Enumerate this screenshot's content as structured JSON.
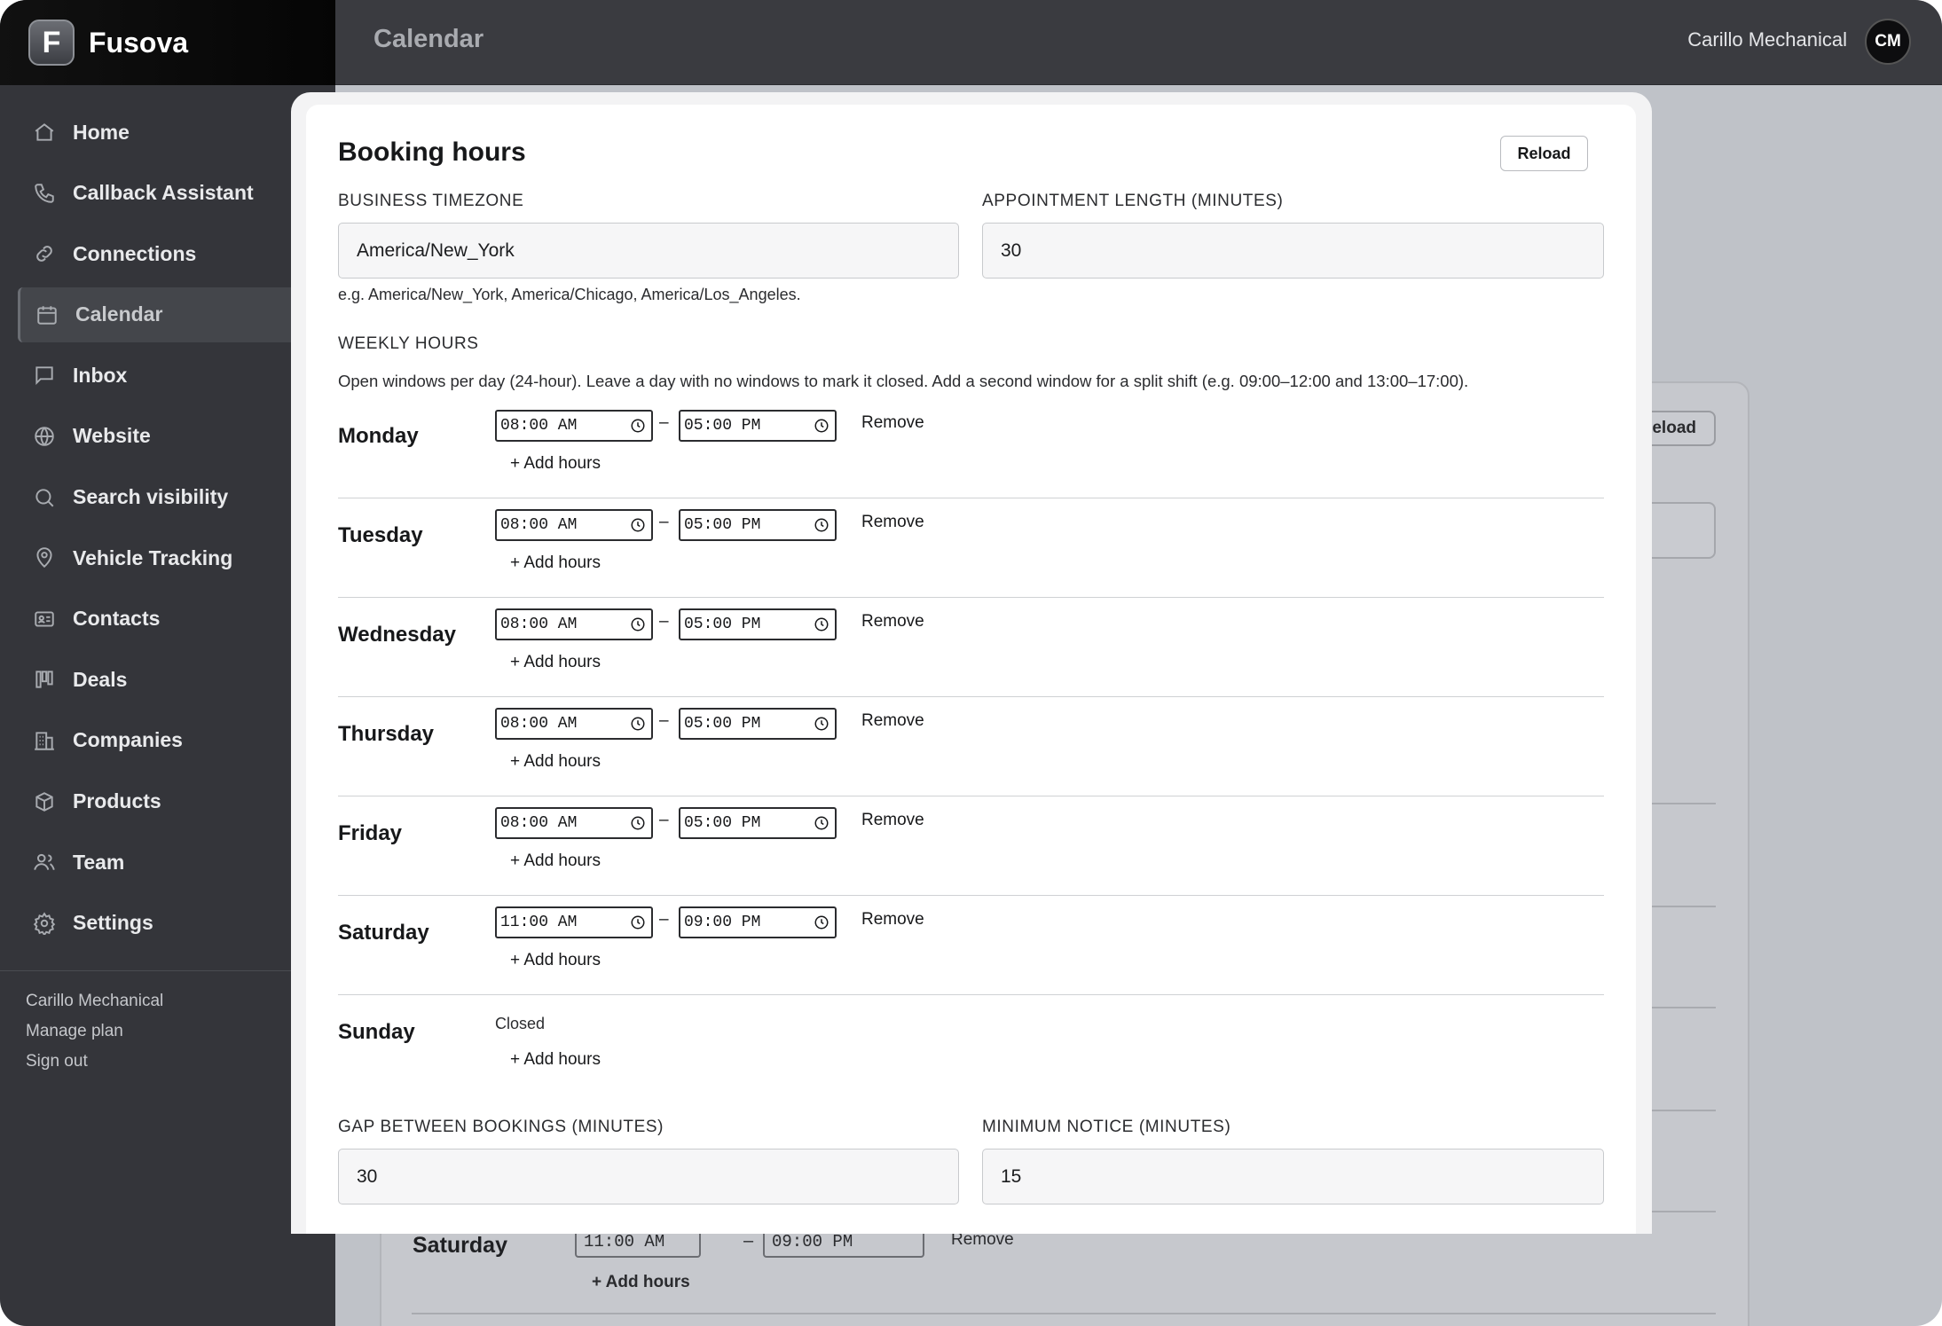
{
  "app": {
    "brand_initial": "F",
    "brand_name": "Fusova",
    "page_title": "Calendar",
    "account_name": "Carillo Mechanical",
    "avatar_initials": "CM"
  },
  "sidebar": {
    "items": [
      {
        "label": "Home",
        "icon": "home-icon"
      },
      {
        "label": "Callback Assistant",
        "icon": "phone-icon"
      },
      {
        "label": "Connections",
        "icon": "link-icon"
      },
      {
        "label": "Calendar",
        "icon": "calendar-icon",
        "active": true
      },
      {
        "label": "Inbox",
        "icon": "chat-icon"
      },
      {
        "label": "Website",
        "icon": "globe-icon"
      },
      {
        "label": "Search visibility",
        "icon": "search-icon"
      },
      {
        "label": "Vehicle Tracking",
        "icon": "map-pin-icon"
      },
      {
        "label": "Contacts",
        "icon": "contact-card-icon"
      },
      {
        "label": "Deals",
        "icon": "kanban-icon"
      },
      {
        "label": "Companies",
        "icon": "building-icon"
      },
      {
        "label": "Products",
        "icon": "box-icon"
      },
      {
        "label": "Team",
        "icon": "users-icon"
      },
      {
        "label": "Settings",
        "icon": "gear-icon"
      }
    ],
    "footer": {
      "company": "Carillo Mechanical",
      "manage_plan": "Manage plan",
      "sign_out": "Sign out"
    }
  },
  "modal": {
    "title": "Booking hours",
    "reload_label": "Reload",
    "timezone_label": "BUSINESS TIMEZONE",
    "timezone_value": "America/New_York",
    "timezone_hint": "e.g. America/New_York, America/Chicago, America/Los_Angeles.",
    "appt_length_label": "APPOINTMENT LENGTH (MINUTES)",
    "appt_length_value": "30",
    "weekly_label": "WEEKLY HOURS",
    "weekly_desc": "Open windows per day (24-hour). Leave a day with no windows to mark it closed. Add a second window for a split shift (e.g. 09:00–12:00 and 13:00–17:00).",
    "remove_label": "Remove",
    "add_hours_label": "+ Add hours",
    "closed_label": "Closed",
    "dash": "–",
    "days": [
      {
        "name": "Monday",
        "start": "08:00 AM",
        "end": "05:00 PM"
      },
      {
        "name": "Tuesday",
        "start": "08:00 AM",
        "end": "05:00 PM"
      },
      {
        "name": "Wednesday",
        "start": "08:00 AM",
        "end": "05:00 PM"
      },
      {
        "name": "Thursday",
        "start": "08:00 AM",
        "end": "05:00 PM"
      },
      {
        "name": "Friday",
        "start": "08:00 AM",
        "end": "05:00 PM"
      },
      {
        "name": "Saturday",
        "start": "11:00 AM",
        "end": "09:00 PM"
      },
      {
        "name": "Sunday",
        "closed": true
      }
    ],
    "gap_label": "GAP BETWEEN BOOKINGS (MINUTES)",
    "gap_value": "30",
    "notice_label": "MINIMUM NOTICE (MINUTES)",
    "notice_value": "15"
  },
  "background": {
    "reload_label": "Reload",
    "day_name": "Saturday",
    "start": "11:00 AM",
    "end": "09:00 PM",
    "remove_label": "Remove",
    "add_hours_label": "+ Add hours"
  }
}
